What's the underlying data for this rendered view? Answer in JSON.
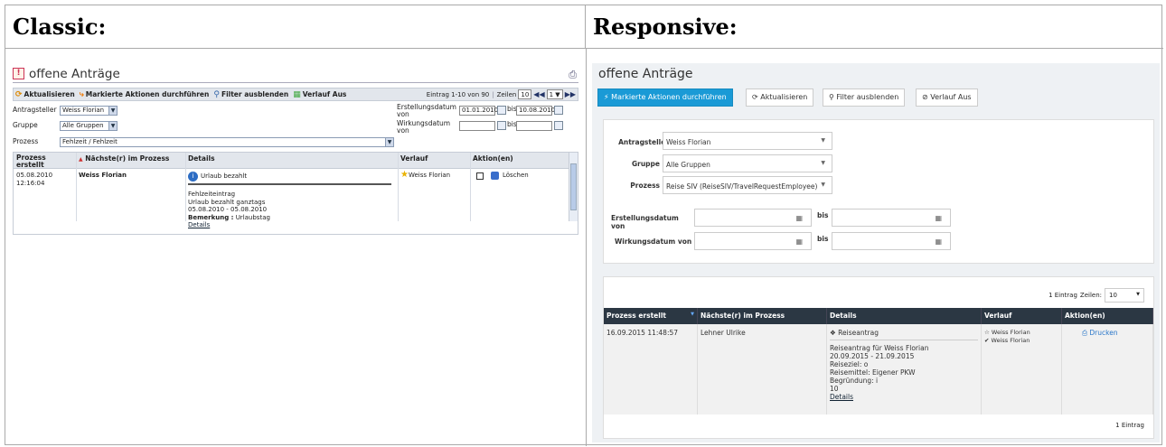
{
  "headers": {
    "classic": "Classic:",
    "responsive": "Responsive:"
  },
  "classic": {
    "title": "offene Anträge",
    "toolbar": {
      "refresh": "Aktualisieren",
      "marked_actions": "Markierte Aktionen durchführen",
      "filter_hide": "Filter ausblenden",
      "history_off": "Verlauf Aus",
      "entries": "Eintrag 1-10 von 90",
      "rows_label": "Zeilen",
      "rows_value": "10",
      "page_value": "1"
    },
    "filters": {
      "applicant_label": "Antragsteller",
      "applicant_value": "Weiss Florian",
      "group_label": "Gruppe",
      "group_value": "Alle Gruppen",
      "process_label": "Prozess",
      "process_value": "Fehlzeit / Fehlzeit",
      "created_label": "Erstellungsdatum von",
      "created_from": "01.01.2010",
      "created_to": "10.08.2010",
      "effective_label": "Wirkungsdatum von",
      "bis": "bis"
    },
    "table": {
      "columns": [
        "Prozess erstellt",
        "Nächste(r) im Prozess",
        "Details",
        "Verlauf",
        "Aktion(en)"
      ],
      "row": {
        "created": "05.08.2010 12:16:04",
        "next": "Weiss Florian",
        "details_title": "Urlaub bezahlt",
        "details_lines": [
          "Fehlzeiteintrag",
          "Urlaub bezahlt  ganztags",
          "05.08.2010 - 05.08.2010"
        ],
        "remark_label": "Bemerkung :",
        "remark_value": "Urlaubstag",
        "details_link": "Details",
        "history": "Weiss Florian",
        "action": "Löschen"
      }
    }
  },
  "responsive": {
    "title": "offene Anträge",
    "buttons": {
      "marked_actions": "Markierte Aktionen durchführen",
      "refresh": "Aktualisieren",
      "filter_hide": "Filter ausblenden",
      "history_off": "Verlauf Aus"
    },
    "filters": {
      "applicant_label": "Antragsteller",
      "applicant_value": "Weiss Florian",
      "group_label": "Gruppe",
      "group_value": "Alle Gruppen",
      "process_label": "Prozess",
      "process_value": "Reise SIV (ReiseSIV/TravelRequestEmployee)",
      "created_label": "Erstellungsdatum von",
      "effective_label": "Wirkungsdatum von",
      "bis": "bis"
    },
    "table": {
      "entries_top": "1 Eintrag",
      "rows_label": "Zeilen:",
      "rows_value": "10",
      "columns": [
        "Prozess erstellt",
        "Nächste(r) im Prozess",
        "Details",
        "Verlauf",
        "Aktion(en)"
      ],
      "row": {
        "created": "16.09.2015 11:48:57",
        "next": "Lehner Ulrike",
        "details_title": "Reiseantrag",
        "details_lines": [
          "Reiseantrag für Weiss Florian",
          "20.09.2015 - 21.09.2015",
          "Reiseziel: o",
          "Reisemittel: Eigener PKW",
          "Begründung: i",
          "10"
        ],
        "details_link": "Details",
        "history": [
          "Weiss Florian",
          "Weiss Florian"
        ],
        "action": "Drucken"
      },
      "entries_bottom": "1 Eintrag"
    }
  },
  "colors": {
    "primary": "#1a9ad6",
    "table_header_dark": "#2b3743",
    "classic_header": "#e2e6ec"
  }
}
